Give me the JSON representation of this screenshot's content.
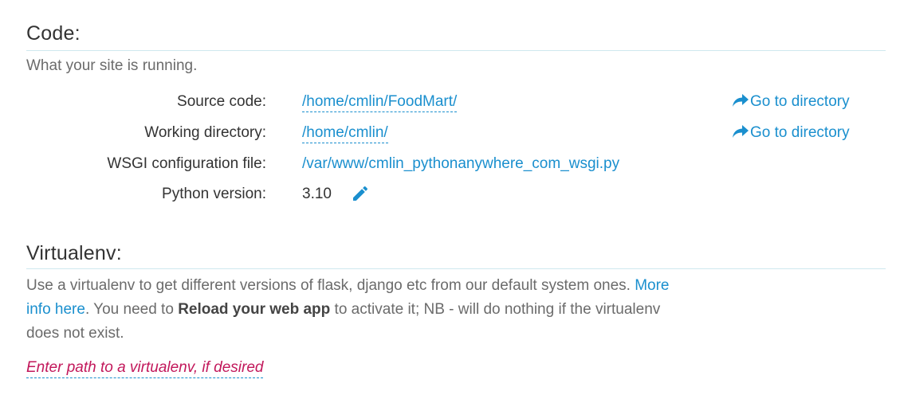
{
  "code": {
    "title": "Code:",
    "description": "What your site is running.",
    "rows": [
      {
        "label": "Source code:",
        "value": "/home/cmlin/FoodMart/",
        "action": "Go to directory"
      },
      {
        "label": "Working directory:",
        "value": "/home/cmlin/",
        "action": "Go to directory"
      },
      {
        "label": "WSGI configuration file:",
        "value": "/var/www/cmlin_pythonanywhere_com_wsgi.py"
      },
      {
        "label": "Python version:",
        "value": "3.10"
      }
    ],
    "icons": {
      "go": "share-arrow-icon",
      "edit": "pencil-icon"
    }
  },
  "virtualenv": {
    "title": "Virtualenv:",
    "text_before": "Use a virtualenv to get different versions of flask, django etc from our default system ones. ",
    "more_info_link": "More info here",
    "text_middle": ". You need to ",
    "bold_text": "Reload your web app",
    "text_after": " to activate it; NB - will do nothing if the virtualenv does not exist.",
    "input_placeholder": "Enter path to a virtualenv, if desired"
  },
  "colors": {
    "link": "#1a8fce",
    "placeholder": "#c2185b",
    "rule": "#cfe8ef"
  }
}
